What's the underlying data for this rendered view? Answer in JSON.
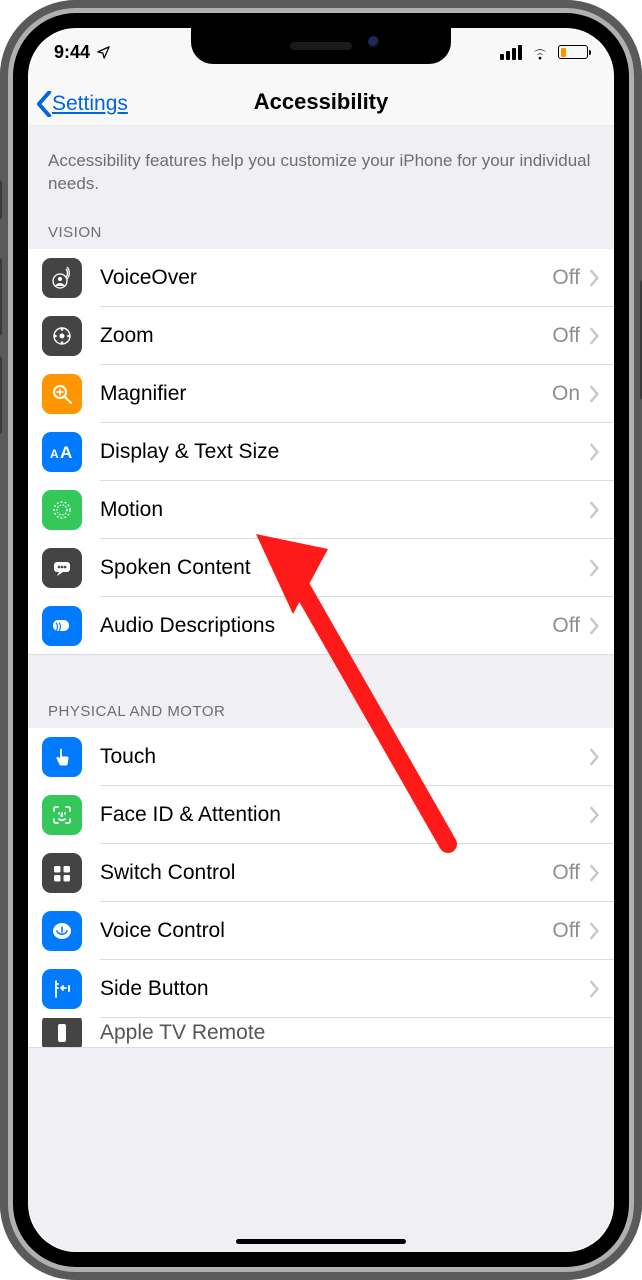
{
  "status": {
    "time": "9:44"
  },
  "nav": {
    "back_label": "Settings",
    "title": "Accessibility"
  },
  "intro": "Accessibility features help you customize your iPhone for your individual needs.",
  "sections": {
    "vision": {
      "header": "VISION",
      "items": [
        {
          "label": "VoiceOver",
          "value": "Off",
          "icon": "voiceover",
          "bg": "#444444"
        },
        {
          "label": "Zoom",
          "value": "Off",
          "icon": "zoom",
          "bg": "#444444"
        },
        {
          "label": "Magnifier",
          "value": "On",
          "icon": "magnifier",
          "bg": "#ff9500"
        },
        {
          "label": "Display & Text Size",
          "value": "",
          "icon": "textsize",
          "bg": "#007aff"
        },
        {
          "label": "Motion",
          "value": "",
          "icon": "motion",
          "bg": "#34c759"
        },
        {
          "label": "Spoken Content",
          "value": "",
          "icon": "spoken",
          "bg": "#444444"
        },
        {
          "label": "Audio Descriptions",
          "value": "Off",
          "icon": "audiodesc",
          "bg": "#007aff"
        }
      ]
    },
    "physical": {
      "header": "PHYSICAL AND MOTOR",
      "items": [
        {
          "label": "Touch",
          "value": "",
          "icon": "touch",
          "bg": "#007aff"
        },
        {
          "label": "Face ID & Attention",
          "value": "",
          "icon": "faceid",
          "bg": "#34c759"
        },
        {
          "label": "Switch Control",
          "value": "Off",
          "icon": "switch",
          "bg": "#444444"
        },
        {
          "label": "Voice Control",
          "value": "Off",
          "icon": "voicecontrol",
          "bg": "#007aff"
        },
        {
          "label": "Side Button",
          "value": "",
          "icon": "sidebutton",
          "bg": "#007aff"
        },
        {
          "label": "Apple TV Remote",
          "value": "",
          "icon": "appletv",
          "bg": "#444444"
        }
      ]
    }
  }
}
